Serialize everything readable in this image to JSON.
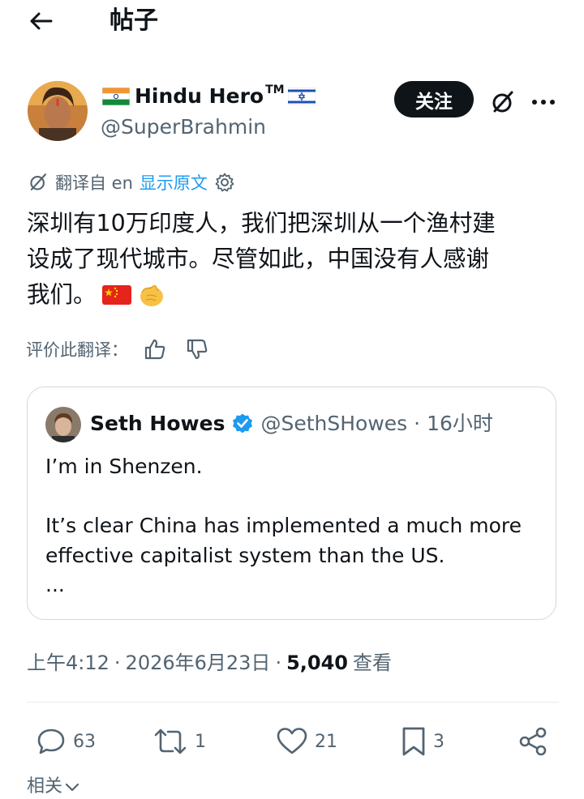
{
  "header": {
    "title": "帖子",
    "back_icon": "arrow-left-icon"
  },
  "author": {
    "name": "Hindu Hero",
    "tm": "TM",
    "handle": "@SuperBrahmin",
    "follow_label": "关注"
  },
  "translation": {
    "translated_from": "翻译自 en",
    "show_original": "显示原文"
  },
  "tweet": {
    "line1": "深圳有10万印度人，我们把深圳从一个渔村建",
    "line2": "设成了现代城市。尽管如此，中国没有人感谢",
    "line3": "我们。"
  },
  "rate_translation": {
    "label": "评价此翻译："
  },
  "quoted": {
    "name": "Seth Howes",
    "handle": "@SethSHowes",
    "sep": "·",
    "time": "16小时",
    "text": "I’m in Shenzen.\n\nIt’s clear China has implemented a much more\neffective capitalist system than the US.\n..."
  },
  "meta": {
    "time": "上午4:12",
    "sep1": "·",
    "date": "2026年6月23日",
    "sep2": "·",
    "views": "5,040",
    "views_label": "查看"
  },
  "actions": {
    "replies": "63",
    "retweets": "1",
    "likes": "21",
    "bookmarks": "3"
  },
  "related": {
    "label": "相关"
  },
  "colors": {
    "accent": "#1d9bf0",
    "text": "#0f1419",
    "muted": "#536471",
    "verified": "#1d9bf0"
  }
}
